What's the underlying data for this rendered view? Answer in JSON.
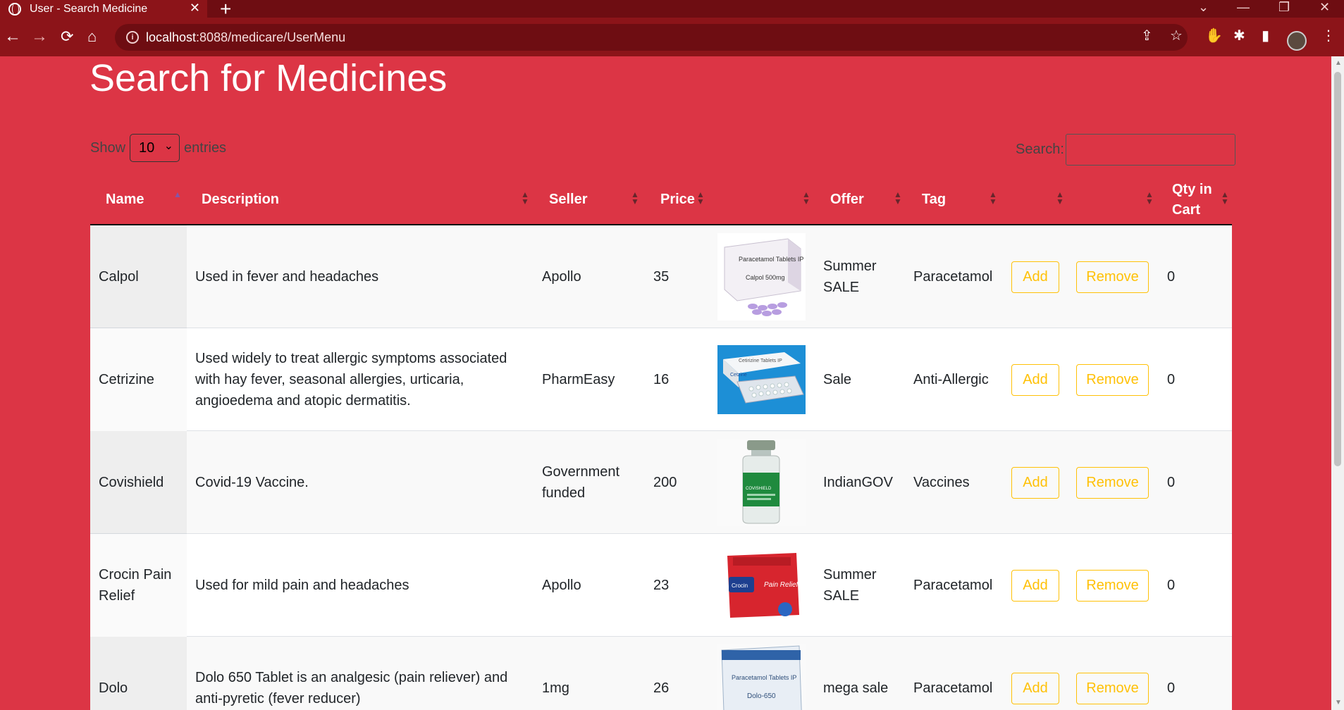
{
  "browser": {
    "tab_title": "User - Search Medicine",
    "tab_close": "✕",
    "new_tab": "+",
    "url_host": "localhost",
    "url_rest": ":8088/medicare/UserMenu",
    "window_controls": [
      "⌄",
      "—",
      "❐",
      "✕"
    ]
  },
  "page": {
    "title": "Search for Medicines",
    "show_label": "Show",
    "entries_value": "10",
    "entries_label": "entries",
    "search_label": "Search:"
  },
  "table": {
    "headers": {
      "name": "Name",
      "description": "Description",
      "seller": "Seller",
      "price": "Price",
      "image": "",
      "offer": "Offer",
      "tag": "Tag",
      "add": "",
      "remove": "",
      "qty": "Qty in Cart"
    },
    "rows": [
      {
        "name": "Calpol",
        "description": "Used in fever and headaches",
        "seller": "Apollo",
        "price": "35",
        "offer": "Summer SALE",
        "tag": "Paracetamol",
        "add": "Add",
        "remove": "Remove",
        "qty": "0",
        "image_label": "Paracetamol Tablets IP",
        "image_sub": "Calpol 500mg"
      },
      {
        "name": "Cetrizine",
        "description": "Used widely to treat allergic symptoms associated with hay fever, seasonal allergies, urticaria, angioedema and atopic dermatitis.",
        "seller": "PharmEasy",
        "price": "16",
        "offer": "Sale",
        "tag": "Anti-Allergic",
        "add": "Add",
        "remove": "Remove",
        "qty": "0",
        "image_label": "Cetirizine Tablets IP",
        "image_sub": "Cetzine"
      },
      {
        "name": "Covishield",
        "description": "Covid-19 Vaccine.",
        "seller": "Government funded",
        "price": "200",
        "offer": "IndianGOV",
        "tag": "Vaccines",
        "add": "Add",
        "remove": "Remove",
        "qty": "0",
        "image_label": "COVISHIELD",
        "image_sub": ""
      },
      {
        "name": "Crocin Pain Relief",
        "description": "Used for mild pain and headaches",
        "seller": "Apollo",
        "price": "23",
        "offer": "Summer SALE",
        "tag": "Paracetamol",
        "add": "Add",
        "remove": "Remove",
        "qty": "0",
        "image_label": "Crocin",
        "image_sub": "Pain Relief"
      },
      {
        "name": "Dolo",
        "description": "Dolo 650 Tablet is an analgesic (pain reliever) and anti-pyretic (fever reducer)",
        "seller": "1mg",
        "price": "26",
        "offer": "mega sale",
        "tag": "Paracetamol",
        "add": "Add",
        "remove": "Remove",
        "qty": "0",
        "image_label": "Paracetamol Tablets IP",
        "image_sub": "Dolo-650"
      }
    ]
  },
  "colors": {
    "page_bg": "#dc3545",
    "chrome_dark": "#6e0d12",
    "chrome": "#8c1419",
    "button_warning": "#ffc107"
  }
}
